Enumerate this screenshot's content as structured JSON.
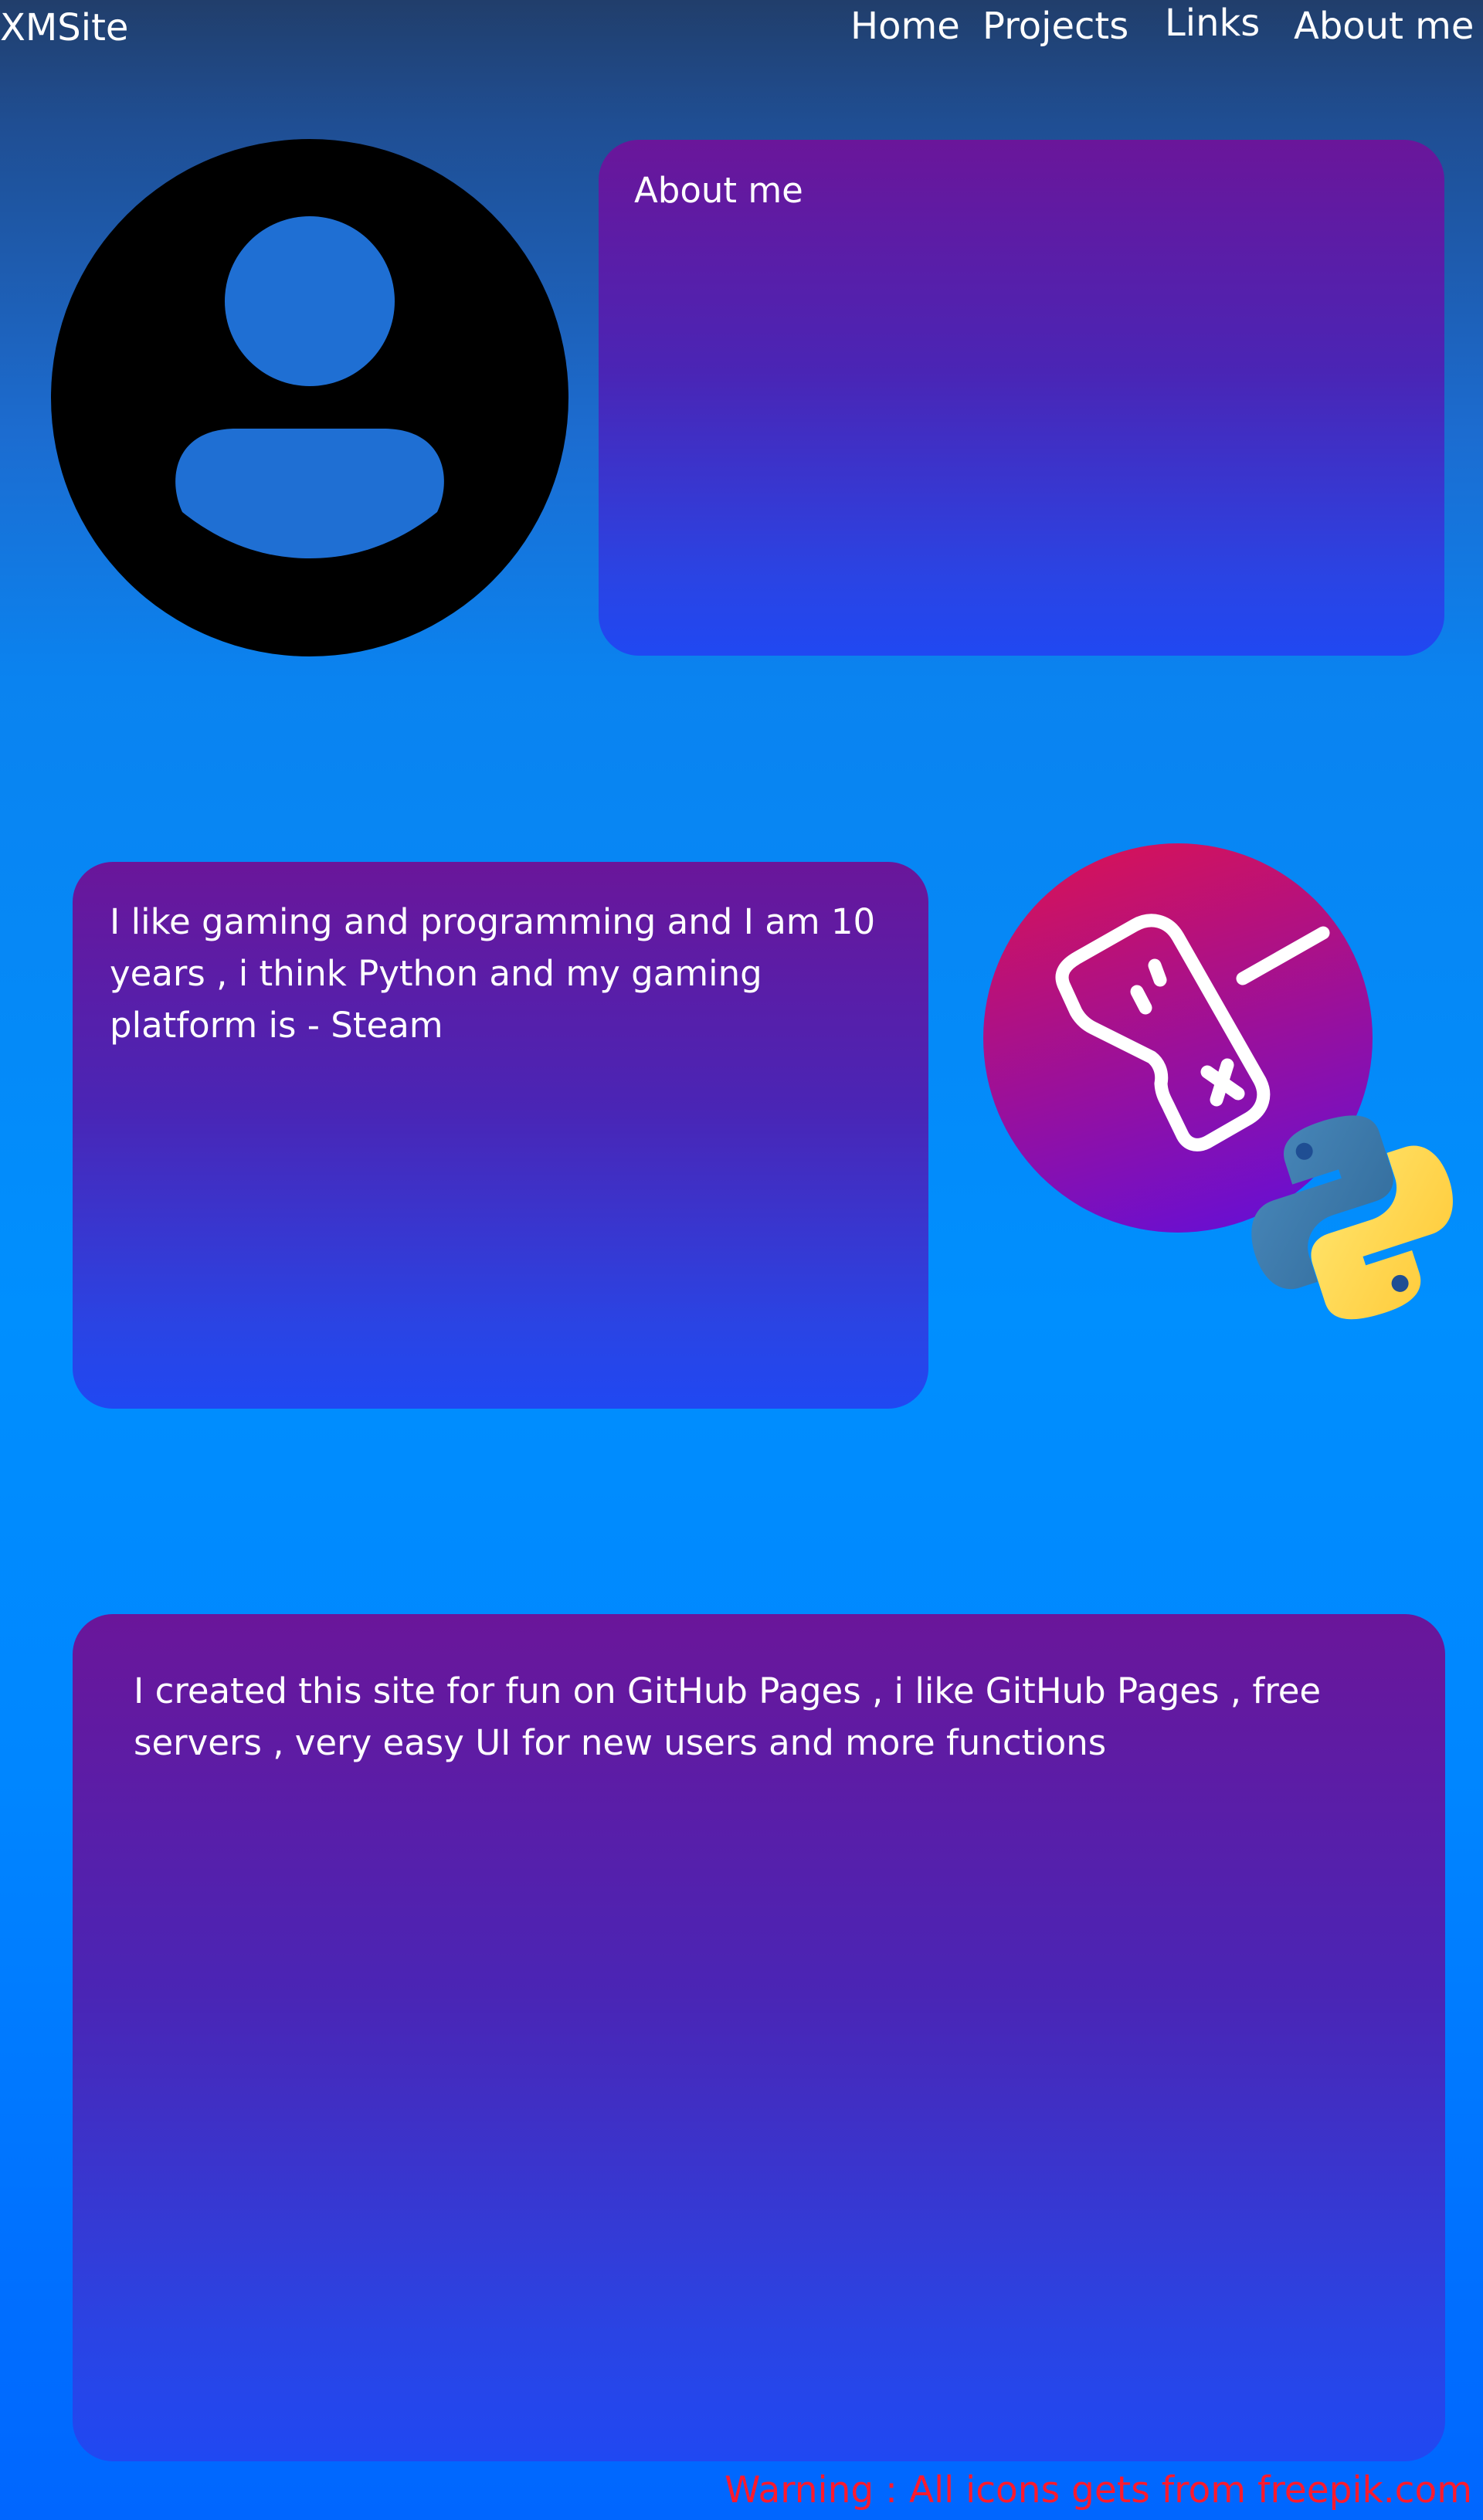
{
  "header": {
    "brand": "XMSite",
    "nav": [
      "Home",
      "Projects",
      "Links",
      "About me"
    ]
  },
  "about_card": {
    "title": "About me"
  },
  "interests_card": {
    "text": "I like gaming and programming and I am 10 years , i think Python and my gaming platform is - Steam"
  },
  "site_card": {
    "text": "I created this site for fun on GitHub Pages , i like GitHub Pages , free servers , very easy UI for new users and more functions"
  },
  "footer": {
    "warning": "Warning : All icons gets from freepik.com"
  },
  "icons": {
    "avatar": "user-avatar-icon",
    "gamepad": "gamepad-icon",
    "python": "python-logo-icon"
  },
  "colors": {
    "card_top": "#6a169a",
    "card_bottom": "#2048f2",
    "warning": "#ff1a2e",
    "badge_top": "#d5125a",
    "badge_bottom": "#6a0fd0"
  }
}
